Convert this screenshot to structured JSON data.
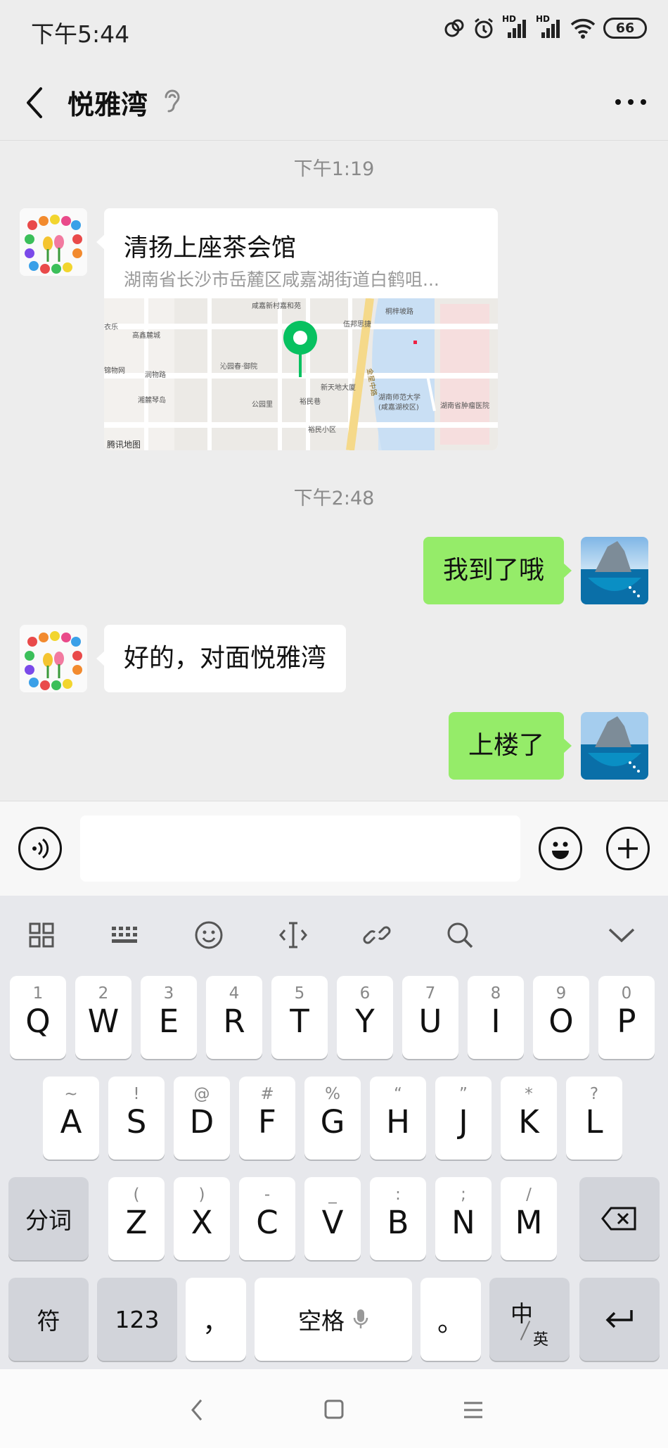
{
  "status_bar": {
    "time": "下午5:44",
    "hd1": "HD",
    "hd2": "HD",
    "battery": "66"
  },
  "header": {
    "title": "悦雅湾"
  },
  "messages": {
    "time1": "下午1:19",
    "location": {
      "title": "清扬上座茶会馆",
      "address": "湖南省长沙市岳麓区咸嘉湖街道白鹤咀...",
      "map_labels": [
        "咸嘉新村嘉和苑",
        "桐梓坡路",
        "伍邦思捷",
        "高鑫麓城",
        "沁园春·御院",
        "润物路",
        "新天地大厦",
        "湖南师范大学",
        "(咸嘉湖校区)",
        "湖南省肿瘤医院",
        "湘麓琴岛",
        "公园里",
        "裕民巷",
        "裕民小区",
        "金星中路",
        "腾讯地图",
        "衣乐",
        "锦物网"
      ]
    },
    "time2": "下午2:48",
    "sent1": "我到了哦",
    "recv1": "好的，对面悦雅湾",
    "sent2": "上楼了"
  },
  "input": {
    "placeholder": ""
  },
  "keyboard": {
    "row1": [
      {
        "sub": "1",
        "main": "Q"
      },
      {
        "sub": "2",
        "main": "W"
      },
      {
        "sub": "3",
        "main": "E"
      },
      {
        "sub": "4",
        "main": "R"
      },
      {
        "sub": "5",
        "main": "T"
      },
      {
        "sub": "6",
        "main": "Y"
      },
      {
        "sub": "7",
        "main": "U"
      },
      {
        "sub": "8",
        "main": "I"
      },
      {
        "sub": "9",
        "main": "O"
      },
      {
        "sub": "0",
        "main": "P"
      }
    ],
    "row2": [
      {
        "sub": "~",
        "main": "A"
      },
      {
        "sub": "!",
        "main": "S"
      },
      {
        "sub": "@",
        "main": "D"
      },
      {
        "sub": "#",
        "main": "F"
      },
      {
        "sub": "%",
        "main": "G"
      },
      {
        "sub": "“",
        "main": "H"
      },
      {
        "sub": "”",
        "main": "J"
      },
      {
        "sub": "*",
        "main": "K"
      },
      {
        "sub": "?",
        "main": "L"
      }
    ],
    "row3": [
      {
        "sub": "(",
        "main": "Z"
      },
      {
        "sub": ")",
        "main": "X"
      },
      {
        "sub": "-",
        "main": "C"
      },
      {
        "sub": "_",
        "main": "V"
      },
      {
        "sub": ":",
        "main": "B"
      },
      {
        "sub": ";",
        "main": "N"
      },
      {
        "sub": "/",
        "main": "M"
      }
    ],
    "segment": "分词",
    "symbols": "符",
    "numbers": "123",
    "comma": "，",
    "space": "空格",
    "period": "。",
    "lang_main": "中",
    "lang_sub": "英"
  },
  "colors": {
    "sent_bubble": "#95ec69",
    "accent_green": "#07c160",
    "background": "#ededed"
  }
}
